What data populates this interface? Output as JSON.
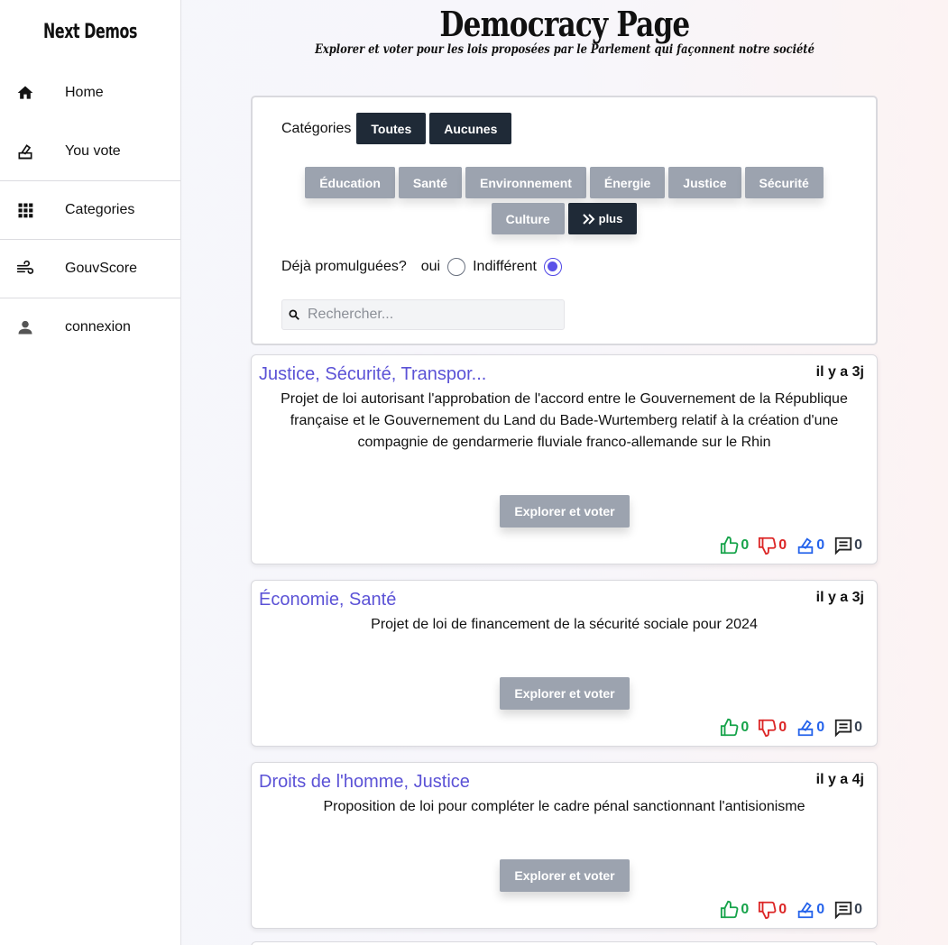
{
  "sidebar": {
    "brand": "Next Demos",
    "items": [
      {
        "label": "Home",
        "icon": "home-icon"
      },
      {
        "label": "You vote",
        "icon": "ballot-icon"
      },
      {
        "label": "Categories",
        "icon": "grid-icon"
      },
      {
        "label": "GouvScore",
        "icon": "wind-icon"
      },
      {
        "label": "connexion",
        "icon": "user-icon"
      }
    ]
  },
  "header": {
    "title": "Democracy Page",
    "subtitle": "Explorer et voter pour les lois proposées par le Parlement qui façonnent notre société"
  },
  "filters": {
    "categories_label": "Catégories",
    "all_label": "Toutes",
    "none_label": "Aucunes",
    "tags": [
      "Éducation",
      "Santé",
      "Environnement",
      "Énergie",
      "Justice",
      "Sécurité",
      "Culture"
    ],
    "more_label": "plus",
    "promulgated_label": "Déjà promulguées?",
    "option_yes": "oui",
    "option_any": "Indifférent",
    "selected_option": "Indifférent",
    "search_placeholder": "Rechercher..."
  },
  "laws": [
    {
      "categories": "Justice, Sécurité, Transpor...",
      "date": "il y a 3j",
      "description": "Projet de loi autorisant l'approbation de l'accord entre le Gouvernement de la République française et le Gouvernement du Land du Bade-Wurtemberg relatif à la création d'une compagnie de gendarmerie fluviale franco-allemande sur le Rhin",
      "button": "Explorer et voter",
      "likes": "0",
      "dislikes": "0",
      "votes": "0",
      "comments": "0"
    },
    {
      "categories": "Économie, Santé",
      "date": "il y a 3j",
      "description": "Projet de loi de financement de la sécurité sociale pour 2024",
      "button": "Explorer et voter",
      "likes": "0",
      "dislikes": "0",
      "votes": "0",
      "comments": "0"
    },
    {
      "categories": "Droits de l'homme, Justice",
      "date": "il y a 4j",
      "description": "Proposition de loi pour compléter le cadre pénal sanctionnant l'antisionisme",
      "button": "Explorer et voter",
      "likes": "0",
      "dislikes": "0",
      "votes": "0",
      "comments": "0"
    }
  ],
  "colors": {
    "accent": "#5b52d6",
    "dark_button": "#1f2a37",
    "gray_button": "#9ca3af",
    "like": "#16a34a",
    "dislike": "#dc2626",
    "vote": "#2563eb"
  }
}
